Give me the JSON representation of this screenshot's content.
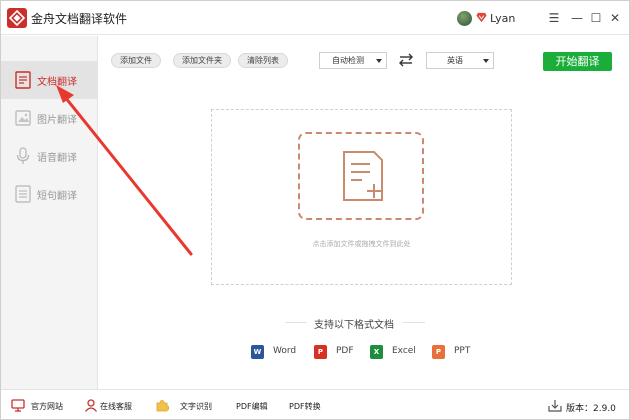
{
  "app": {
    "title": "金舟文档翻译软件",
    "username": "Lyan"
  },
  "window_controls": {
    "menu": "☰",
    "minimize": "—",
    "maximize": "☐",
    "close": "✕"
  },
  "sidebar": {
    "items": [
      {
        "label": "文档翻译",
        "icon": "document-icon",
        "active": true
      },
      {
        "label": "图片翻译",
        "icon": "image-icon",
        "active": false
      },
      {
        "label": "语音翻译",
        "icon": "microphone-icon",
        "active": false
      },
      {
        "label": "短句翻译",
        "icon": "text-icon",
        "active": false
      }
    ]
  },
  "toolbar": {
    "add_file": "添加文件",
    "add_folder": "添加文件夹",
    "clear_list": "清除列表",
    "source_lang": "自动检测",
    "target_lang": "英语",
    "start": "开始翻译"
  },
  "dropzone": {
    "hint": "点击添加文件或拖拽文件到此处"
  },
  "formats": {
    "title": "支持以下格式文档",
    "items": [
      {
        "label": "Word",
        "icon_letter": "W",
        "color": "#2b579a"
      },
      {
        "label": "PDF",
        "icon_letter": "P",
        "color": "#d93025"
      },
      {
        "label": "Excel",
        "icon_letter": "X",
        "color": "#1e8e3e"
      },
      {
        "label": "PPT",
        "icon_letter": "P",
        "color": "#e8703a"
      }
    ]
  },
  "bottombar": {
    "website": "官方网站",
    "support": "在线客服",
    "ocr": "文字识别",
    "pdf_edit": "PDF编辑",
    "pdf_convert": "PDF转换",
    "version": "版本：2.9.0"
  },
  "colors": {
    "accent": "#c9302c",
    "start_button": "#1aad3a",
    "annotation_arrow": "#e8392f"
  }
}
